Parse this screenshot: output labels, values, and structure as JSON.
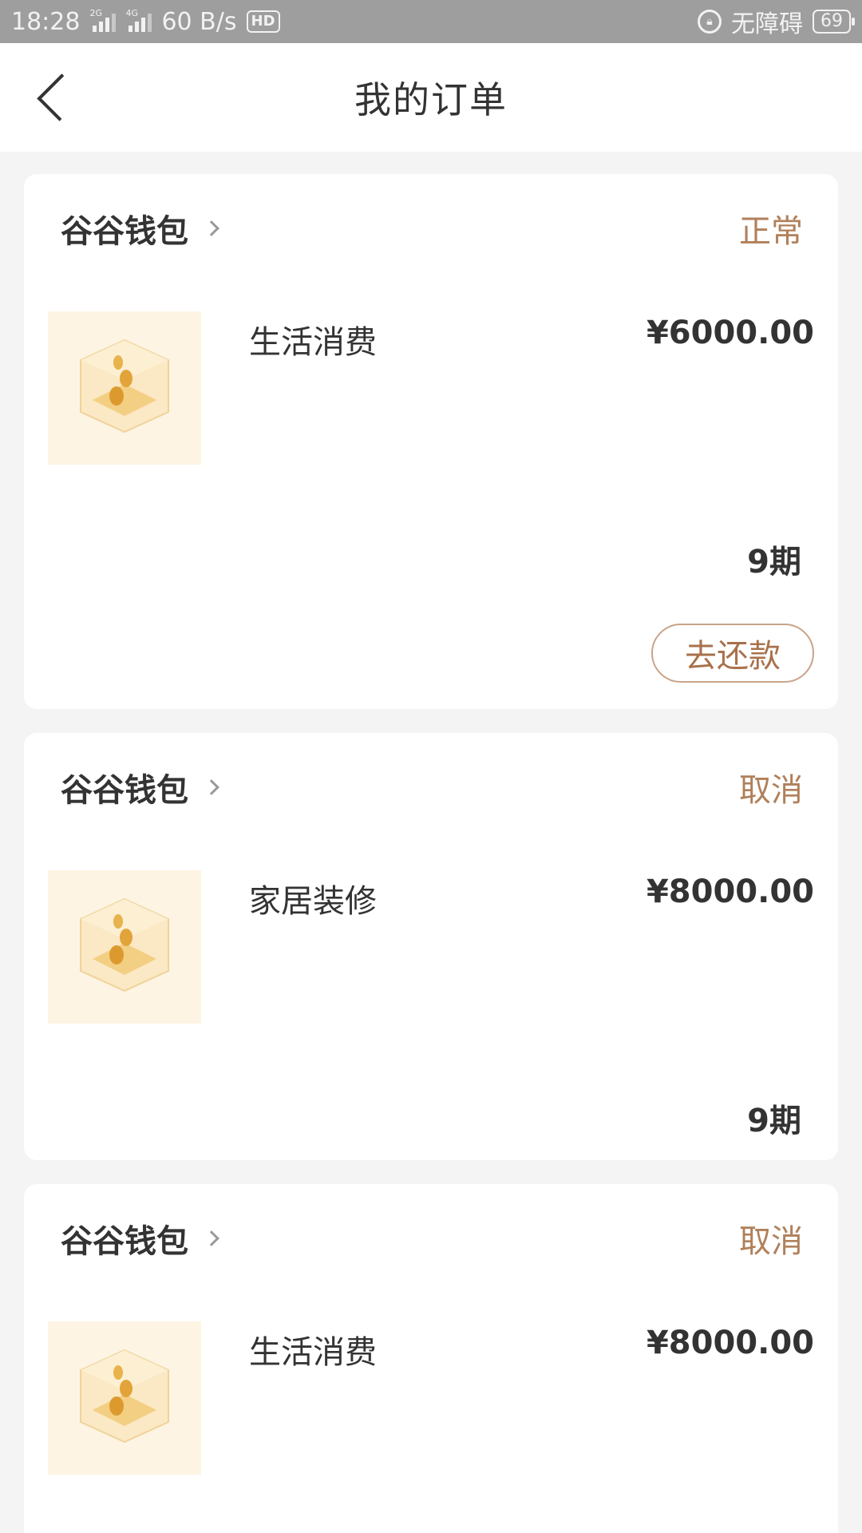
{
  "status_bar": {
    "time": "18:28",
    "network_2g": "2G",
    "network_4g": "4G",
    "speed": "60 B/s",
    "hd": "HD",
    "accessibility": "无障碍",
    "battery": "69"
  },
  "header": {
    "title": "我的订单"
  },
  "orders": [
    {
      "merchant": "谷谷钱包",
      "status": "正常",
      "product": "生活消费",
      "amount": "¥6000.00",
      "periods": "9期",
      "action": "去还款"
    },
    {
      "merchant": "谷谷钱包",
      "status": "取消",
      "product": "家居装修",
      "amount": "¥8000.00",
      "periods": "9期"
    },
    {
      "merchant": "谷谷钱包",
      "status": "取消",
      "product": "生活消费",
      "amount": "¥8000.00"
    }
  ],
  "colors": {
    "accent": "#b0805a",
    "status_bar": "#9e9e9e",
    "thumb_bg": "#fdf4e3"
  }
}
